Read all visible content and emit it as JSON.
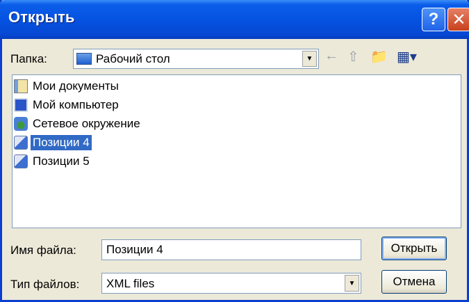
{
  "window": {
    "title": "Открыть"
  },
  "titlebar_buttons": {
    "help": "?",
    "close": "✕"
  },
  "lookin": {
    "label": "Папка:",
    "value": "Рабочий стол"
  },
  "toolbar": {
    "back_icon": "←",
    "up_icon": "⇧",
    "new_folder_icon": "📁",
    "view_icon": "▦▾"
  },
  "files": [
    {
      "name": "Мои документы",
      "icon": "my-documents-icon",
      "selected": false
    },
    {
      "name": "Мой компьютер",
      "icon": "my-computer-icon",
      "selected": false
    },
    {
      "name": "Сетевое окружение",
      "icon": "network-places-icon",
      "selected": false
    },
    {
      "name": "Позиции 4",
      "icon": "xml-file-icon",
      "selected": true
    },
    {
      "name": "Позиции 5",
      "icon": "xml-file-icon",
      "selected": false
    }
  ],
  "filename": {
    "label": "Имя файла:",
    "value": "Позиции 4"
  },
  "filetype": {
    "label": "Тип файлов:",
    "value": "XML files"
  },
  "buttons": {
    "open": "Открыть",
    "cancel": "Отмена"
  },
  "colors": {
    "titlebar": "#0553e1",
    "selection": "#316ac5",
    "dialog_bg": "#ece9d8"
  }
}
